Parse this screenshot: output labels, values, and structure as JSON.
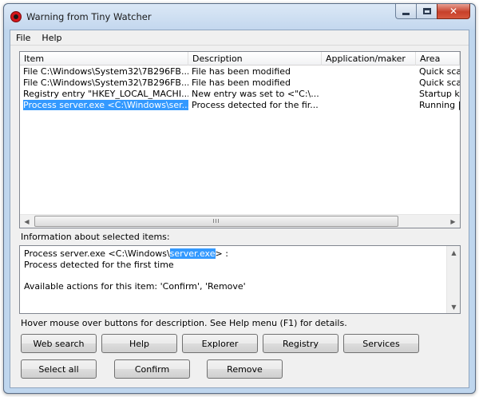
{
  "window": {
    "title": "Warning from Tiny Watcher"
  },
  "menu": {
    "file": "File",
    "help": "Help"
  },
  "list": {
    "columns": [
      "Item",
      "Description",
      "Application/maker",
      "Area"
    ],
    "rows": [
      {
        "item": "File C:\\Windows\\System32\\7B296FB...",
        "description": "File has been modified",
        "app": "",
        "area": "Quick sca",
        "selected": false
      },
      {
        "item": "File C:\\Windows\\System32\\7B296FB...",
        "description": "File has been modified",
        "app": "",
        "area": "Quick sca",
        "selected": false
      },
      {
        "item": "Registry entry \"HKEY_LOCAL_MACHI...",
        "description": "New entry was set to <\"C:\\...",
        "app": "",
        "area": "Startup k",
        "selected": false
      },
      {
        "item": "Process server.exe <C:\\Windows\\ser...",
        "description": "Process detected for the fir...",
        "app": "",
        "area": "Running |",
        "selected": true
      }
    ],
    "scroll_thumb_grip": "III"
  },
  "info": {
    "label": "Information about selected items:",
    "line1_pre": "Process server.exe <C:\\Windows\\",
    "line1_highlight": "server.exe",
    "line1_post": "> :",
    "line2": "Process detected for the first time",
    "line3": "Available actions for this item: 'Confirm', 'Remove'"
  },
  "hint": "Hover mouse over buttons for description. See Help menu (F1) for details.",
  "buttons": {
    "web_search": "Web search",
    "help": "Help",
    "explorer": "Explorer",
    "registry": "Registry",
    "services": "Services",
    "select_all": "Select all",
    "confirm": "Confirm",
    "remove": "Remove"
  },
  "colors": {
    "selection": "#3399ff",
    "title_bg": "#c3d7ee",
    "close_button": "#c7402a"
  }
}
